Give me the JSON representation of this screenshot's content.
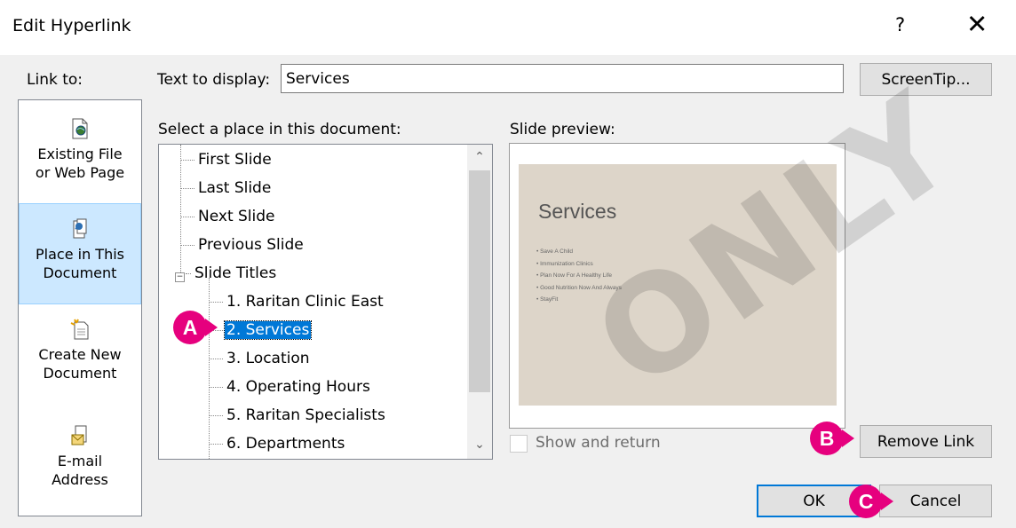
{
  "dialog": {
    "title": "Edit Hyperlink",
    "help_label": "?",
    "close_label": "✕"
  },
  "link_to": {
    "label": "Link to:",
    "items": [
      {
        "label_line1": "Existing File",
        "label_line2": "or Web Page",
        "icon": "existing-file-icon"
      },
      {
        "label_line1": "Place in This",
        "label_line2": "Document",
        "icon": "place-in-document-icon"
      },
      {
        "label_line1": "Create New",
        "label_line2": "Document",
        "icon": "create-new-document-icon"
      },
      {
        "label_line1": "E-mail",
        "label_line2": "Address",
        "icon": "email-address-icon"
      }
    ]
  },
  "text_to_display": {
    "label": "Text to display:",
    "value": "Services"
  },
  "screentip_label": "ScreenTip...",
  "place_label": "Select a place in this document:",
  "tree": {
    "items": [
      {
        "label": "First Slide"
      },
      {
        "label": "Last Slide"
      },
      {
        "label": "Next Slide"
      },
      {
        "label": "Previous Slide"
      },
      {
        "label": "Slide Titles"
      },
      {
        "label": "1. Raritan Clinic East"
      },
      {
        "label": "2. Services"
      },
      {
        "label": "3. Location"
      },
      {
        "label": "4. Operating Hours"
      },
      {
        "label": "5. Raritan Specialists"
      },
      {
        "label": "6. Departments"
      }
    ],
    "selected": "2. Services"
  },
  "preview": {
    "label": "Slide preview:",
    "slide_title": "Services",
    "bullets": [
      "Save A Child",
      "Immunization Clinics",
      "Plan Now For A Healthy Life",
      "Good Nutrition Now And Always",
      "StayFit"
    ],
    "slide_color": "#ddd5c9"
  },
  "show_return": {
    "label": "Show and return",
    "checked": false
  },
  "buttons": {
    "remove_link": "Remove Link",
    "ok": "OK",
    "cancel": "Cancel"
  },
  "callouts": {
    "a": "A",
    "b": "B",
    "c": "C",
    "color": "#e6007e"
  },
  "watermark": "ONLY"
}
